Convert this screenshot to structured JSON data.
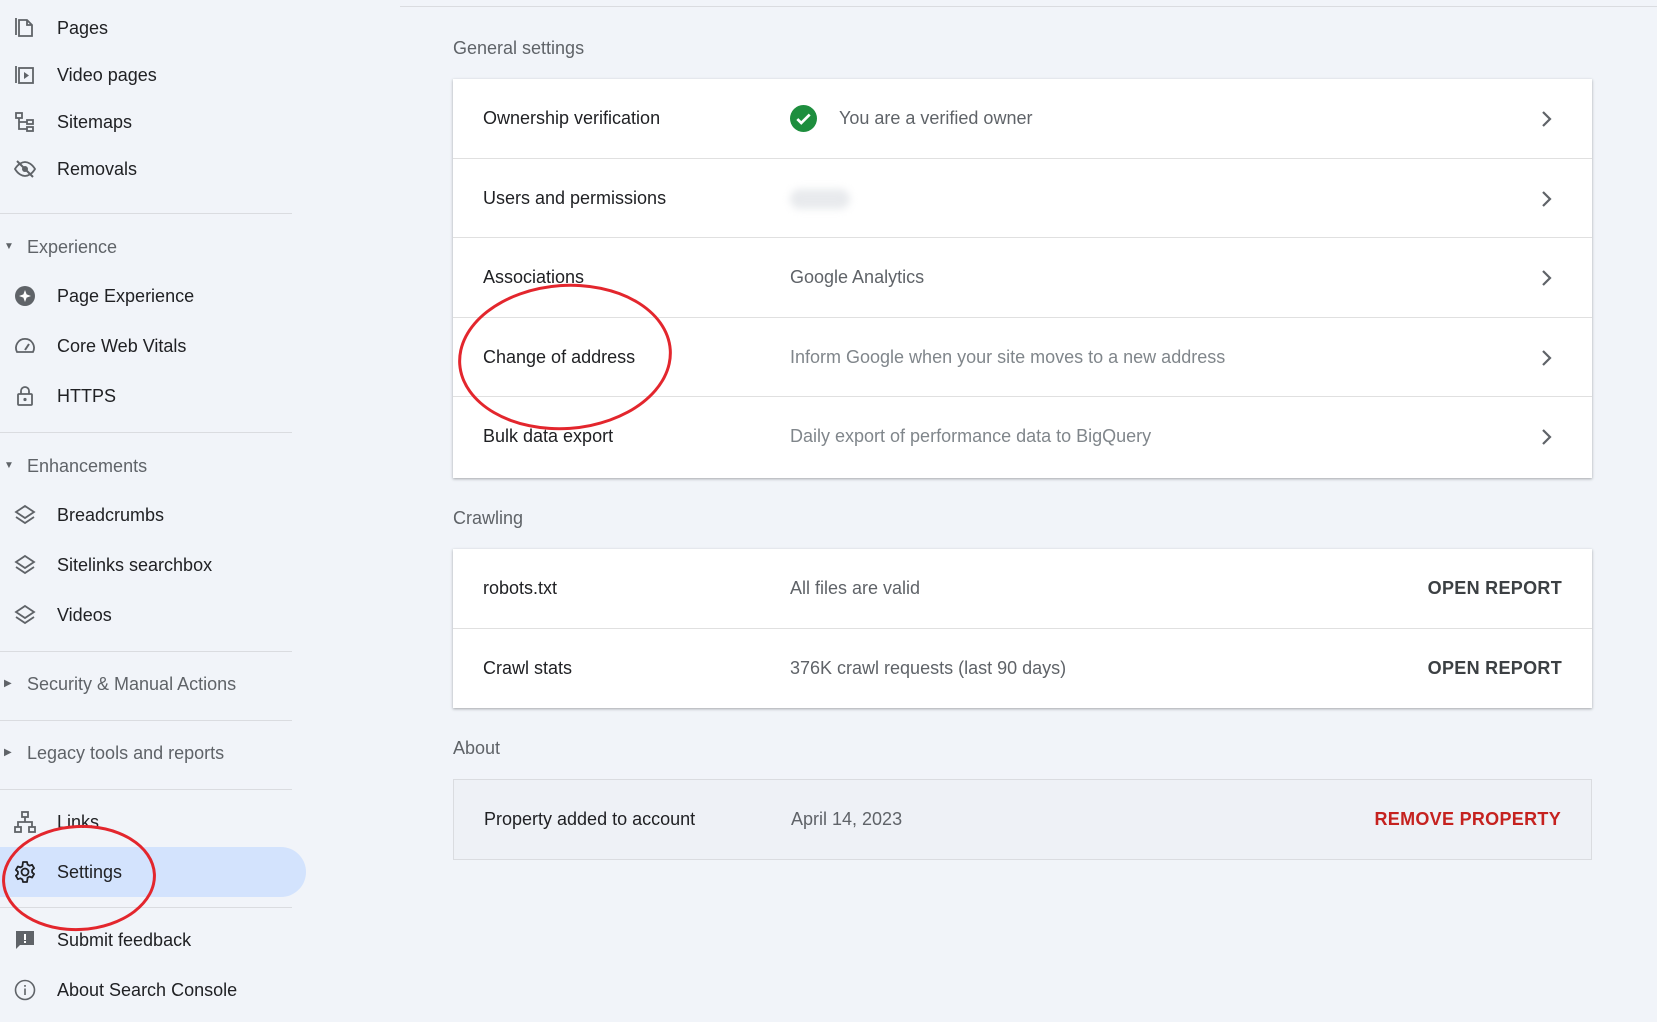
{
  "sidebar": {
    "items_top": [
      {
        "label": "Pages",
        "icon": "pages-icon"
      },
      {
        "label": "Video pages",
        "icon": "video-pages-icon"
      },
      {
        "label": "Sitemaps",
        "icon": "sitemaps-icon"
      },
      {
        "label": "Removals",
        "icon": "removals-icon"
      }
    ],
    "experience": {
      "header": "Experience",
      "items": [
        {
          "label": "Page Experience",
          "icon": "page-experience-icon"
        },
        {
          "label": "Core Web Vitals",
          "icon": "speedometer-icon"
        },
        {
          "label": "HTTPS",
          "icon": "lock-icon"
        }
      ]
    },
    "enhancements": {
      "header": "Enhancements",
      "items": [
        {
          "label": "Breadcrumbs",
          "icon": "layers-icon"
        },
        {
          "label": "Sitelinks searchbox",
          "icon": "layers-icon"
        },
        {
          "label": "Videos",
          "icon": "layers-icon"
        }
      ]
    },
    "security_header": "Security & Manual Actions",
    "legacy_header": "Legacy tools and reports",
    "links_label": "Links",
    "settings_label": "Settings",
    "feedback_label": "Submit feedback",
    "about_label": "About Search Console",
    "active_color": "#d3e3fd"
  },
  "general": {
    "title": "General settings",
    "rows": [
      {
        "label": "Ownership verification",
        "value": "You are a verified owner"
      },
      {
        "label": "Users and permissions",
        "value": ""
      },
      {
        "label": "Associations",
        "value": "Google Analytics"
      },
      {
        "label": "Change of address",
        "value": "Inform Google when your site moves to a new address"
      },
      {
        "label": "Bulk data export",
        "value": "Daily export of performance data to BigQuery"
      }
    ]
  },
  "crawling": {
    "title": "Crawling",
    "rows": [
      {
        "label": "robots.txt",
        "value": "All files are valid",
        "action": "OPEN REPORT"
      },
      {
        "label": "Crawl stats",
        "value": "376K crawl requests (last 90 days)",
        "action": "OPEN REPORT"
      }
    ]
  },
  "about": {
    "title": "About",
    "label": "Property added to account",
    "value": "April 14, 2023",
    "action": "REMOVE PROPERTY"
  },
  "colors": {
    "verified_green": "#1e8e3e",
    "danger_red": "#c5221f",
    "annotation_red": "#e3262d"
  }
}
